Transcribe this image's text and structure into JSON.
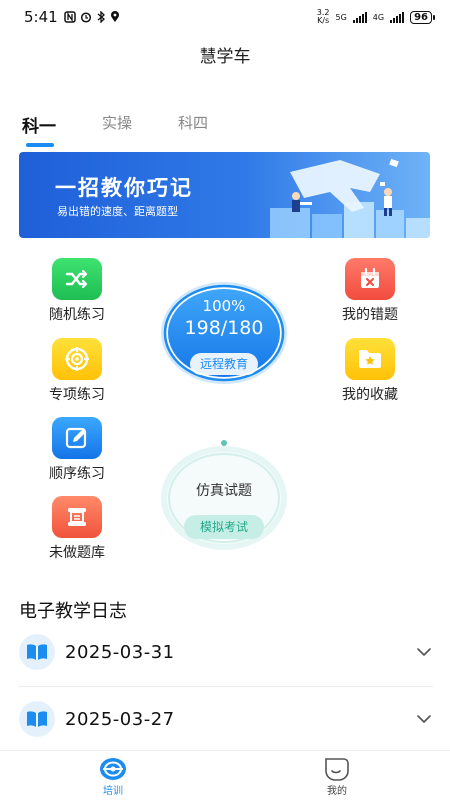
{
  "status_bar": {
    "time": "5:41",
    "net_speed_value": "3.2",
    "net_speed_unit": "K/s",
    "network_1": "5G",
    "network_2": "4G",
    "battery": "96"
  },
  "app": {
    "title": "慧学车"
  },
  "tabs": [
    {
      "label": "科一",
      "active": true
    },
    {
      "label": "实操",
      "active": false
    },
    {
      "label": "科四",
      "active": false
    }
  ],
  "banner": {
    "title": "一招教你巧记",
    "subtitle": "易出错的速度、距离题型"
  },
  "features_left": [
    {
      "label": "随机练习",
      "icon": "shuffle-icon",
      "color": "#2fd062"
    },
    {
      "label": "专项练习",
      "icon": "target-icon",
      "color": "#ffd21f"
    },
    {
      "label": "顺序练习",
      "icon": "edit-icon",
      "color": "#1f8cf5"
    },
    {
      "label": "未做题库",
      "icon": "scroll-icon",
      "color": "#f56a4c"
    }
  ],
  "features_right": [
    {
      "label": "我的错题",
      "icon": "calendar-x-icon",
      "color": "#f4584a"
    },
    {
      "label": "我的收藏",
      "icon": "star-folder-icon",
      "color": "#ffd21f"
    }
  ],
  "progress": {
    "percent_text": "100%",
    "count_text": "198/180",
    "percent_value": 1.0,
    "button_label": "远程教育"
  },
  "exam": {
    "title": "仿真试题",
    "button_label": "模拟考试"
  },
  "log": {
    "title": "电子教学日志",
    "entries": [
      {
        "date": "2025-03-31"
      },
      {
        "date": "2025-03-27"
      }
    ]
  },
  "bottom_nav": [
    {
      "label": "培训",
      "active": true,
      "icon": "steering-wheel-icon"
    },
    {
      "label": "我的",
      "active": false,
      "icon": "profile-face-icon"
    }
  ],
  "colors": {
    "accent": "#1d8cf0",
    "exam_accent": "#20a889"
  }
}
